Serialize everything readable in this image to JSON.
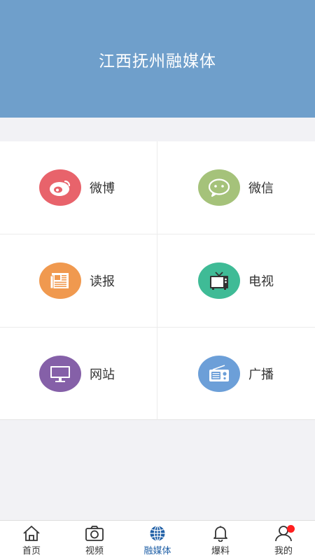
{
  "header": {
    "title": "江西抚州融媒体",
    "bg_color": "#6f9fcb"
  },
  "grid": {
    "items": [
      {
        "label": "微博",
        "icon": "weibo-icon",
        "color": "#e8636b"
      },
      {
        "label": "微信",
        "icon": "wechat-icon",
        "color": "#a5c27a"
      },
      {
        "label": "读报",
        "icon": "newspaper-icon",
        "color": "#f0994f"
      },
      {
        "label": "电视",
        "icon": "tv-icon",
        "color": "#3fbb96"
      },
      {
        "label": "网站",
        "icon": "monitor-icon",
        "color": "#8560a8"
      },
      {
        "label": "广播",
        "icon": "radio-icon",
        "color": "#6c9fd8"
      }
    ]
  },
  "tabbar": {
    "tabs": [
      {
        "label": "首页",
        "icon": "home-icon",
        "active": false
      },
      {
        "label": "视频",
        "icon": "camera-icon",
        "active": false
      },
      {
        "label": "融媒体",
        "icon": "globe-icon",
        "active": true
      },
      {
        "label": "爆料",
        "icon": "bell-icon",
        "active": false
      },
      {
        "label": "我的",
        "icon": "user-icon",
        "active": false,
        "badge": true
      }
    ],
    "active_color": "#1f5fa6",
    "badge_color": "#ff1f1f"
  }
}
